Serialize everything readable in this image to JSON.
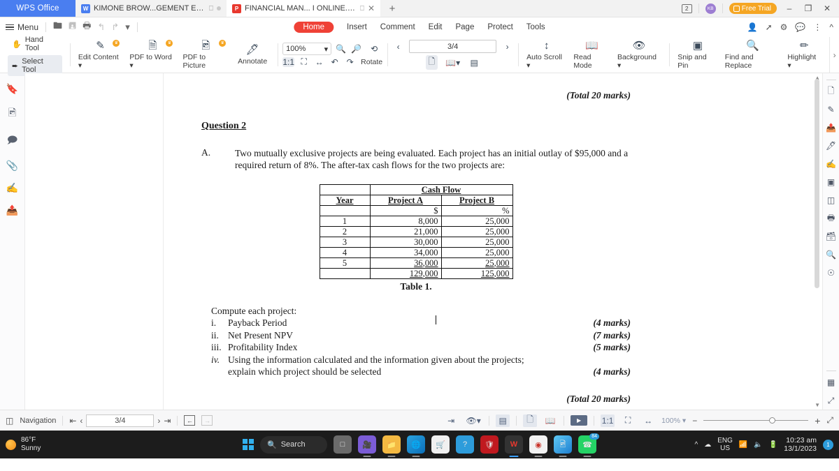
{
  "window": {
    "app_name": "WPS Office",
    "tabs": [
      {
        "title": "KIMONE BROW...GEMENT EXAM",
        "type": "writer",
        "active": false
      },
      {
        "title": "FINANCIAL MAN... I ONLINE.pdf",
        "type": "pdf",
        "active": true
      }
    ],
    "new_tab_label": "+",
    "page_badge": "2",
    "account_initials": "KB",
    "free_trial_label": "Free Trial",
    "minimize": "–",
    "restore": "❐",
    "close": "✕"
  },
  "menu": {
    "menu_label": "Menu",
    "quick_icons": [
      "open-folder-icon",
      "save-icon",
      "print-icon",
      "undo-icon",
      "redo-icon",
      "customize-icon"
    ],
    "ribbon_tabs": [
      {
        "label": "Home",
        "active": true
      },
      {
        "label": "Insert",
        "active": false
      },
      {
        "label": "Comment",
        "active": false
      },
      {
        "label": "Edit",
        "active": false
      },
      {
        "label": "Page",
        "active": false
      },
      {
        "label": "Protect",
        "active": false
      },
      {
        "label": "Tools",
        "active": false
      }
    ],
    "right_icons": [
      "share-user-icon",
      "share-icon",
      "settings-icon",
      "feedback-icon",
      "more-icon",
      "collapse-icon"
    ]
  },
  "toolbar": {
    "hand_tool": "Hand Tool",
    "select_tool": "Select Tool",
    "edit_content": "Edit Content",
    "pdf_to_word": "PDF to Word",
    "pdf_to_picture": "PDF to Picture",
    "annotate": "Annotate",
    "zoom_value": "100%",
    "rotate": "Rotate",
    "page_indicator": "3/4",
    "auto_scroll": "Auto Scroll",
    "read_mode": "Read Mode",
    "background": "Background",
    "snip_and_pin": "Snip and Pin",
    "find_and_replace": "Find and Replace",
    "highlight": "Highlight"
  },
  "left_rail": [
    "bookmark-icon",
    "thumbnail-icon",
    "comment-icon",
    "attachment-icon",
    "signature-icon",
    "export-icon"
  ],
  "right_rail": [
    "add-page-icon",
    "edit-page-icon",
    "extract-page-icon",
    "annotate-page-icon",
    "sign-icon",
    "crop-icon",
    "split-icon",
    "print-icon",
    "compress-icon",
    "ocr-icon",
    "help-icon",
    "apps-icon",
    "fullscreen-icon"
  ],
  "document": {
    "header_marks": "(Total 20 marks)",
    "question_title": "Question 2",
    "part_letter": "A.",
    "part_text": "Two mutually exclusive projects are being evaluated. Each project has an initial outlay of $95,000 and a required return of 8%. The after-tax cash flows for the two projects are:",
    "table": {
      "group_header": "Cash Flow",
      "col_year": "Year",
      "col_a": "Project A",
      "col_b": "Project B",
      "unit_a": "$",
      "unit_b": "%",
      "rows": [
        {
          "year": "1",
          "a": "8,000",
          "b": "25,000"
        },
        {
          "year": "2",
          "a": "21,000",
          "b": "25,000"
        },
        {
          "year": "3",
          "a": "30,000",
          "b": "25,000"
        },
        {
          "year": "4",
          "a": "34,000",
          "b": "25,000"
        },
        {
          "year": "5",
          "a": "36,000",
          "b": "25,000"
        }
      ],
      "total_a": "129,000",
      "total_b": "125,000",
      "caption": "Table 1."
    },
    "compute_intro": "Compute each project:",
    "items": [
      {
        "num": "i.",
        "text": "Payback Period",
        "marks": "(4 marks)"
      },
      {
        "num": "ii.",
        "text": "Net Present NPV",
        "marks": "(7 marks)"
      },
      {
        "num": "iii.",
        "text": "Profitability Index",
        "marks": "(5 marks)"
      },
      {
        "num": "iv.",
        "text": "Using the information calculated and the information given about the projects;",
        "text2": "explain which project should be selected",
        "marks": "(4 marks)"
      }
    ],
    "footer_marks": "(Total 20 marks)"
  },
  "statusbar": {
    "navigation": "Navigation",
    "first_page": "first-page-icon",
    "prev_page": "prev-page-icon",
    "page_value": "3/4",
    "next_page": "next-page-icon",
    "last_page": "last-page-icon",
    "back": "back-icon",
    "forward": "forward-icon",
    "zoom_label": "100%",
    "minus": "−",
    "plus": "+"
  },
  "taskbar": {
    "weather_temp": "86°F",
    "weather_desc": "Sunny",
    "search_label": "Search",
    "apps": [
      {
        "name": "task-view-icon",
        "badge": ""
      },
      {
        "name": "meet-icon",
        "badge": ""
      },
      {
        "name": "file-explorer-icon",
        "badge": ""
      },
      {
        "name": "edge-icon",
        "badge": ""
      },
      {
        "name": "microsoft-store-icon",
        "badge": ""
      },
      {
        "name": "help-icon",
        "badge": ""
      },
      {
        "name": "mcafee-icon",
        "badge": ""
      },
      {
        "name": "wps-office-icon",
        "badge": ""
      },
      {
        "name": "chrome-icon",
        "badge": ""
      },
      {
        "name": "photos-icon",
        "badge": ""
      },
      {
        "name": "whatsapp-icon",
        "badge": "84"
      }
    ],
    "language": "ENG",
    "region": "US",
    "time": "10:23 am",
    "date": "13/1/2023",
    "notification_count": "1"
  },
  "colors": {
    "brand_blue": "#4a7ef0",
    "accent_red": "#ef4136",
    "trial_orange": "#f5a623",
    "taskbar_bg": "#1c1c1c"
  }
}
